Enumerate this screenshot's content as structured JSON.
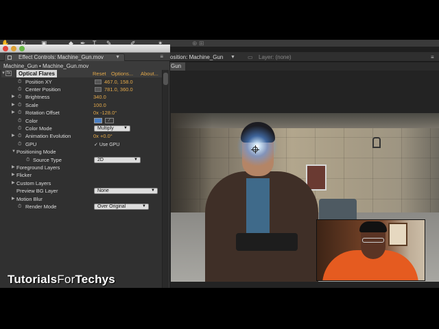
{
  "effect_controls": {
    "tab_label": "Effect Controls: Machine_Gun.mov",
    "breadcrumb": "Machine_Gun • Machine_Gun.mov",
    "effect_name": "Optical Flares",
    "header_links": [
      "Reset",
      "Options...",
      "About..."
    ],
    "properties": {
      "position_xy": {
        "label": "Position XY",
        "value": "467.0, 158.0"
      },
      "center_position": {
        "label": "Center Position",
        "value": "781.0, 360.0"
      },
      "brightness": {
        "label": "Brightness",
        "value": "340.0"
      },
      "scale": {
        "label": "Scale",
        "value": "100.0"
      },
      "rotation_offset": {
        "label": "Rotation Offset",
        "value": "0x -128.0°"
      },
      "color": {
        "label": "Color",
        "swatch": "#4a80c6"
      },
      "color_mode": {
        "label": "Color Mode",
        "value": "Multiply"
      },
      "animation_evolution": {
        "label": "Animation Evolution",
        "value": "0x +0.0°"
      },
      "gpu": {
        "label": "GPU",
        "checkbox_label": "Use GPU",
        "checked": true
      },
      "positioning_mode": {
        "label": "Positioning Mode"
      },
      "source_type": {
        "label": "Source Type",
        "value": "2D"
      },
      "foreground_layers": {
        "label": "Foreground Layers"
      },
      "flicker": {
        "label": "Flicker"
      },
      "custom_layers": {
        "label": "Custom Layers"
      },
      "preview_bg_layer": {
        "label": "Preview BG Layer",
        "value": "None"
      },
      "motion_blur": {
        "label": "Motion Blur"
      },
      "render_mode": {
        "label": "Render Mode",
        "value": "Over Original"
      }
    }
  },
  "composition": {
    "tab_label": "osition: Machine_Gun",
    "layer_tab": "Layer: (none)",
    "sub_tab": "Gun"
  },
  "watermark": {
    "bold_part": "Tutorials",
    "thin_part": "For",
    "bold_part_2": "Techys"
  }
}
